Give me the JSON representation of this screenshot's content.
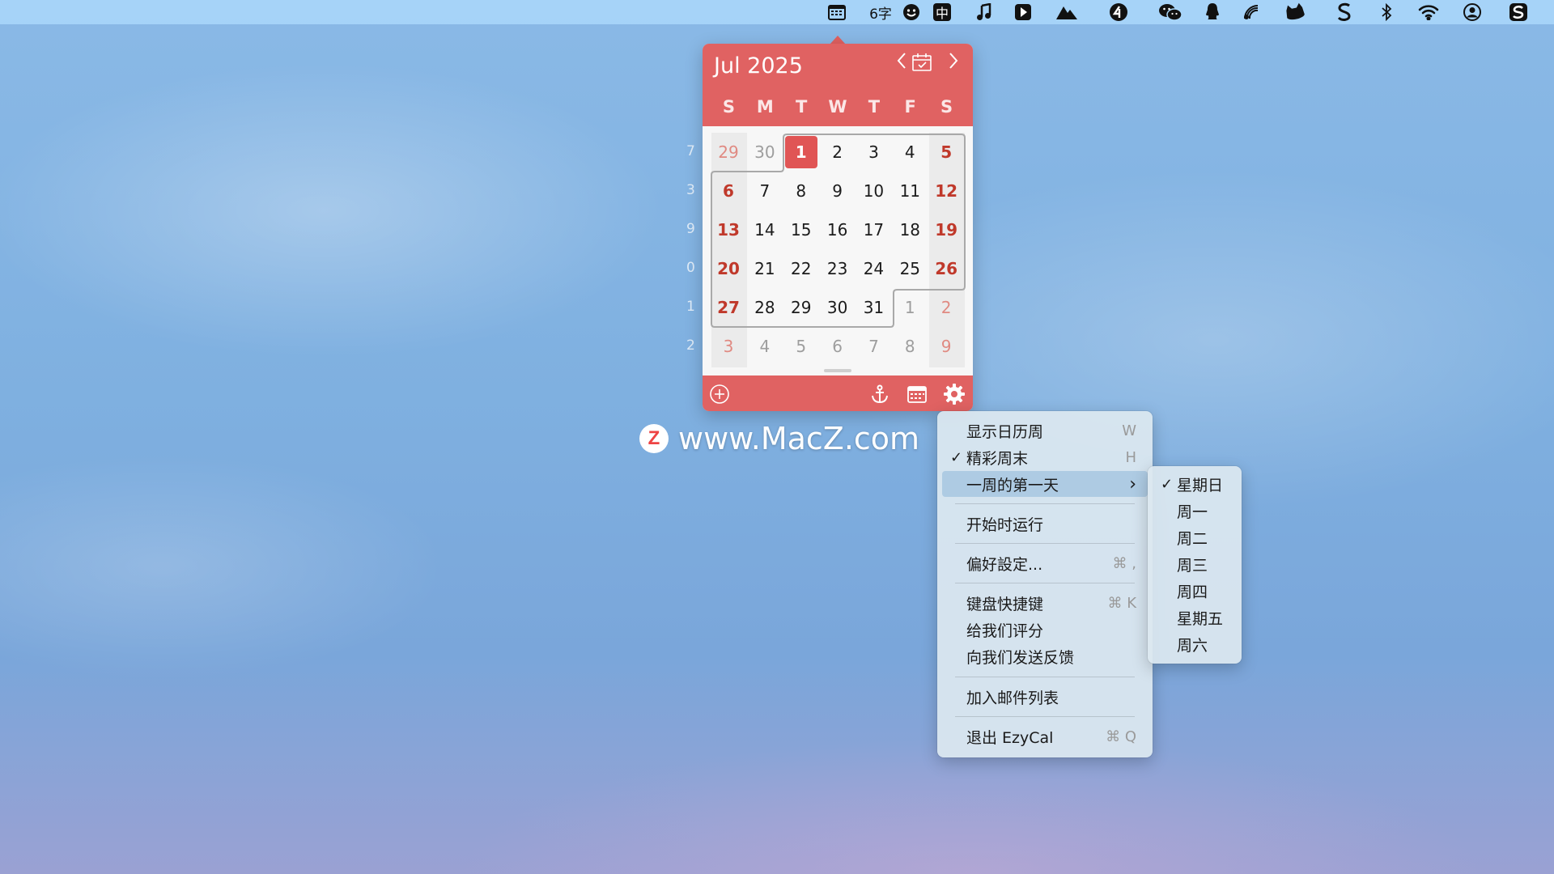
{
  "menubar": {
    "items": [
      {
        "name": "calendar-icon"
      },
      {
        "name": "word-count-status",
        "text": "6字"
      },
      {
        "name": "emoji-icon"
      },
      {
        "name": "input-method-icon",
        "text": "中"
      },
      {
        "name": "music-icon"
      },
      {
        "name": "infuse-icon"
      },
      {
        "name": "mountain-icon"
      },
      {
        "name": "app-4-icon"
      },
      {
        "name": "wechat-icon"
      },
      {
        "name": "qq-icon"
      },
      {
        "name": "rss-icon"
      },
      {
        "name": "cat-icon"
      },
      {
        "name": "s-app-icon"
      },
      {
        "name": "bluetooth-icon"
      },
      {
        "name": "wifi-icon"
      },
      {
        "name": "user-icon"
      },
      {
        "name": "s-logo-icon"
      }
    ]
  },
  "calendar": {
    "month_title": "Jul 2025",
    "weekdays": [
      "S",
      "M",
      "T",
      "W",
      "T",
      "F",
      "S"
    ],
    "weeks": [
      [
        "29",
        "30",
        "1",
        "2",
        "3",
        "4",
        "5"
      ],
      [
        "6",
        "7",
        "8",
        "9",
        "10",
        "11",
        "12"
      ],
      [
        "13",
        "14",
        "15",
        "16",
        "17",
        "18",
        "19"
      ],
      [
        "20",
        "21",
        "22",
        "23",
        "24",
        "25",
        "26"
      ],
      [
        "27",
        "28",
        "29",
        "30",
        "31",
        "1",
        "2"
      ],
      [
        "3",
        "4",
        "5",
        "6",
        "7",
        "8",
        "9"
      ]
    ],
    "dim_cells": [
      [
        0,
        0
      ],
      [
        0,
        1
      ],
      [
        4,
        5
      ],
      [
        4,
        6
      ],
      [
        5,
        0
      ],
      [
        5,
        1
      ],
      [
        5,
        2
      ],
      [
        5,
        3
      ],
      [
        5,
        4
      ],
      [
        5,
        5
      ],
      [
        5,
        6
      ]
    ],
    "today_cell": [
      0,
      2
    ],
    "week_numbers": [
      "7",
      "3",
      "9",
      "0",
      "1",
      "2"
    ],
    "footer": {
      "add_icon": "add-event-icon",
      "anchor_icon": "anchor-icon",
      "calendar_icon": "calendar-icon",
      "settings_icon": "gear-icon"
    },
    "accent_color": "#e06262",
    "weekend_color": "#c0392b"
  },
  "watermark": {
    "logo_letter": "Z",
    "text": "www.MacZ.com"
  },
  "settings_menu": {
    "items": [
      {
        "label": "显示日历周",
        "shortcut": "W",
        "checked": false
      },
      {
        "label": "精彩周末",
        "shortcut": "H",
        "checked": true
      },
      {
        "label": "一周的第一天",
        "submenu": true,
        "highlighted": true
      },
      {
        "label": "开始时运行"
      },
      {
        "label": "偏好設定...",
        "shortcut": "⌘ ,"
      },
      {
        "label": "键盘快捷键",
        "shortcut": "⌘ K"
      },
      {
        "label": "给我们评分"
      },
      {
        "label": "向我们发送反馈"
      },
      {
        "label": "加入邮件列表"
      },
      {
        "label": "退出 EzyCal",
        "shortcut": "⌘ Q"
      }
    ],
    "checkmark": "✓",
    "submenu_arrow": "›"
  },
  "first_day_submenu": {
    "items": [
      {
        "label": "星期日",
        "checked": true
      },
      {
        "label": "周一"
      },
      {
        "label": "周二"
      },
      {
        "label": "周三"
      },
      {
        "label": "周四"
      },
      {
        "label": "星期五"
      },
      {
        "label": "周六"
      }
    ]
  }
}
